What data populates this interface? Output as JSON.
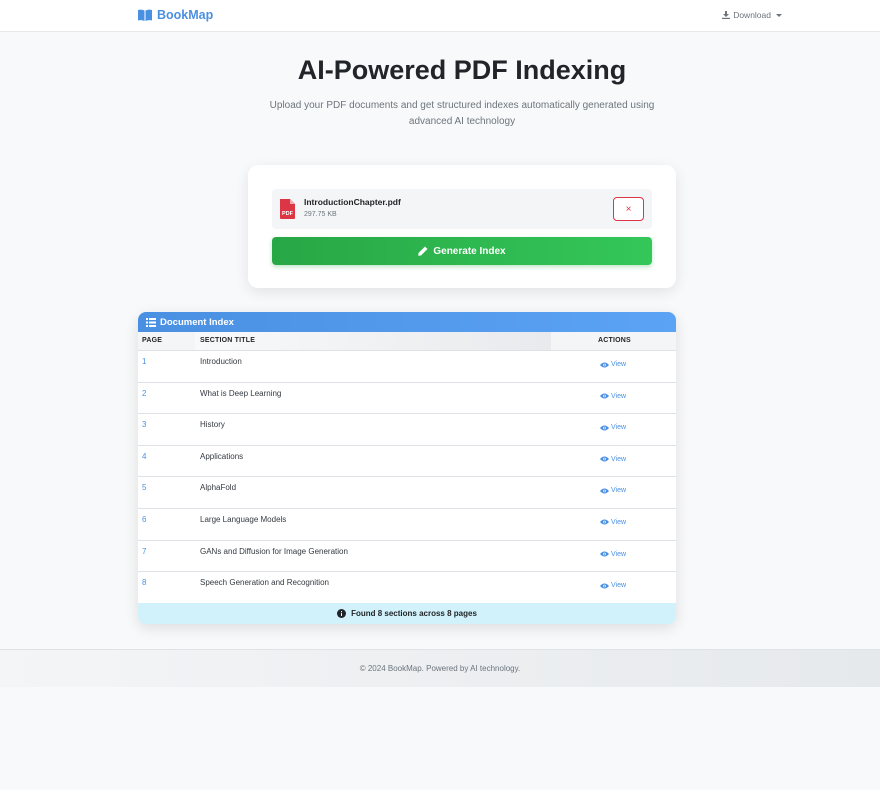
{
  "nav": {
    "brand": "BookMap",
    "download_label": "Download"
  },
  "hero": {
    "title": "AI-Powered PDF Indexing",
    "subtitle": "Upload your PDF documents and get structured indexes automatically generated using advanced AI technology"
  },
  "upload": {
    "file_name": "IntroductionChapter.pdf",
    "file_size": "297.75 KB",
    "file_type_label": "PDF",
    "remove_label": "×",
    "generate_label": "Generate Index"
  },
  "index": {
    "header": "Document Index",
    "columns": [
      "PAGE",
      "SECTION TITLE",
      "ACTIONS"
    ],
    "rows": [
      {
        "page": "1",
        "title": "Introduction",
        "action": "View"
      },
      {
        "page": "2",
        "title": "What is Deep Learning",
        "action": "View"
      },
      {
        "page": "3",
        "title": "History",
        "action": "View"
      },
      {
        "page": "4",
        "title": "Applications",
        "action": "View"
      },
      {
        "page": "5",
        "title": "AlphaFold",
        "action": "View"
      },
      {
        "page": "6",
        "title": "Large Language Models",
        "action": "View"
      },
      {
        "page": "7",
        "title": "GANs and Diffusion for Image Generation",
        "action": "View"
      },
      {
        "page": "8",
        "title": "Speech Generation and Recognition",
        "action": "View"
      }
    ],
    "summary": "Found 8 sections across 8 pages"
  },
  "footer": {
    "text": "© 2024 BookMap. Powered by AI technology."
  },
  "colors": {
    "brand": "#4a90e2",
    "success": "#28a745",
    "danger": "#dc3545",
    "info_bg": "#d1f2fa"
  },
  "icons": {
    "brand": "book-open-icon",
    "download": "download-icon",
    "pdf": "file-pdf-icon",
    "generate": "pencil-icon",
    "index_header": "list-icon",
    "view": "eye-icon",
    "summary": "info-circle-icon"
  }
}
